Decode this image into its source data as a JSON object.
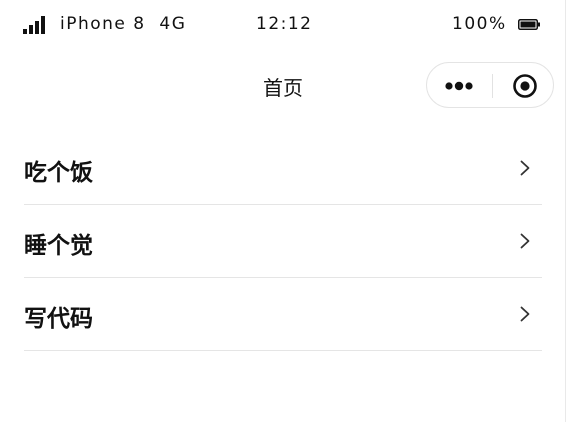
{
  "status_bar": {
    "carrier": "iPhone 8  4G",
    "time": "12:12",
    "battery_percent": "100%",
    "signal_icon": "signal-bars-icon",
    "battery_icon": "battery-full-icon"
  },
  "nav_bar": {
    "title": "首页",
    "more_icon": "more-dots-icon",
    "close_icon": "target-circle-icon"
  },
  "menu_items": [
    {
      "label": "吃个饭",
      "icon": "chevron-right-icon"
    },
    {
      "label": "睡个觉",
      "icon": "chevron-right-icon"
    },
    {
      "label": "写代码",
      "icon": "chevron-right-icon"
    }
  ],
  "colors": {
    "text": "#111111",
    "divider": "#e5e5e5",
    "background": "#ffffff",
    "chevron": "#333333"
  }
}
